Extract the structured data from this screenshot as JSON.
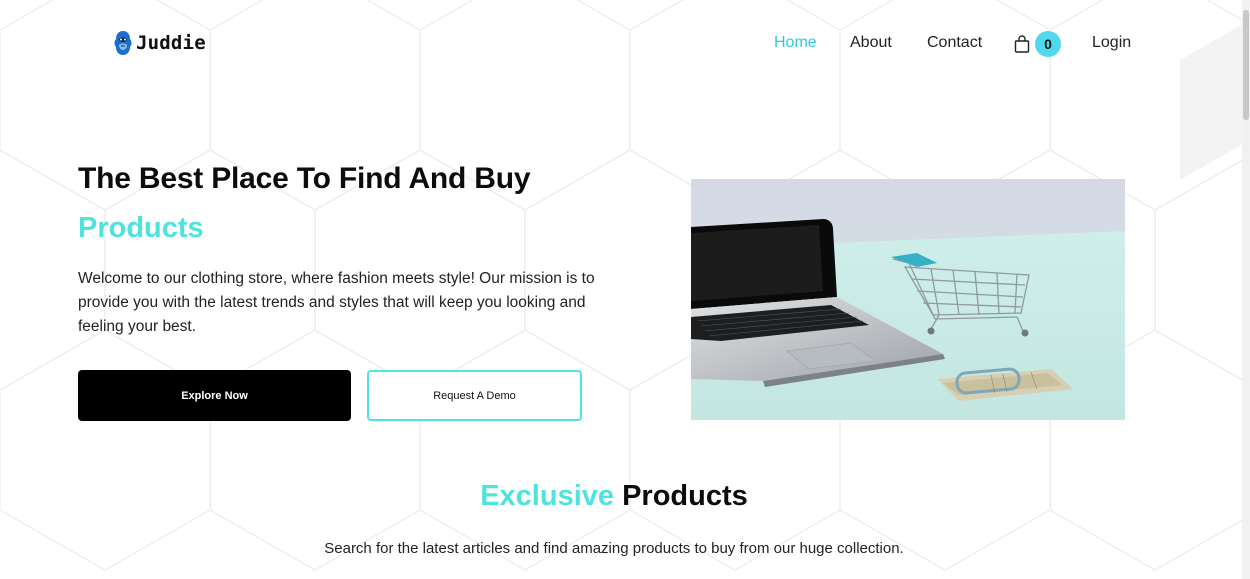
{
  "brand": {
    "name": "Juddie",
    "logo_icon": "gorilla-icon"
  },
  "nav": {
    "items": [
      {
        "label": "Home",
        "active": true
      },
      {
        "label": "About",
        "active": false
      },
      {
        "label": "Contact",
        "active": false
      }
    ],
    "cart": {
      "icon": "shopping-bag-icon",
      "count": "0"
    },
    "login_label": "Login"
  },
  "hero": {
    "title": "The Best Place To Find And Buy",
    "accent": "Products",
    "description": "Welcome to our clothing store, where fashion meets style! Our mission is to provide you with the latest trends and styles that will keep you looking and feeling your best.",
    "primary_button": "Explore Now",
    "secondary_button": "Request A Demo",
    "image_description": "laptop-with-shopping-cart-and-cash"
  },
  "exclusive": {
    "title_accent": "Exclusive",
    "title_rest": "Products",
    "subtitle": "Search for the latest articles and find amazing products to buy from our huge collection."
  },
  "colors": {
    "accent": "#4ee3dd",
    "nav_active": "#2fc8e0",
    "badge": "#4fd9ec",
    "primary_button": "#000000"
  }
}
